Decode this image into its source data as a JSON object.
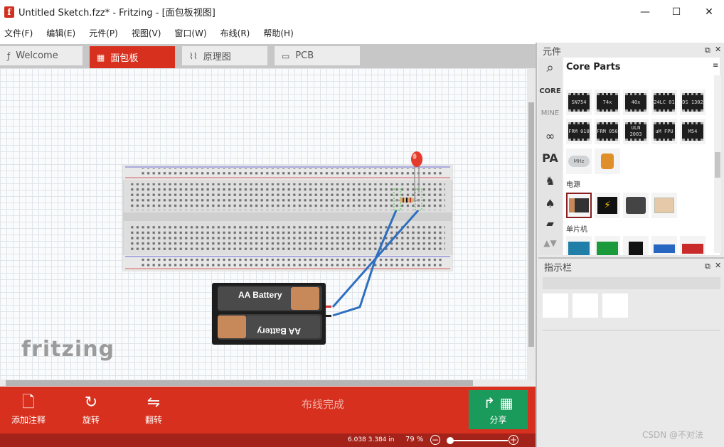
{
  "window": {
    "title": "Untitled Sketch.fzz* - Fritzing - [面包板视图]",
    "minimize": "—",
    "maximize": "☐",
    "close": "✕"
  },
  "menu": [
    "文件(F)",
    "编辑(E)",
    "元件(P)",
    "视图(V)",
    "窗口(W)",
    "布线(R)",
    "帮助(H)"
  ],
  "tabs": [
    {
      "label": "Welcome",
      "icon": "fritzing-f-icon",
      "active": false
    },
    {
      "label": "面包板",
      "icon": "breadboard-icon",
      "active": true
    },
    {
      "label": "原理图",
      "icon": "schematic-icon",
      "active": false
    },
    {
      "label": "PCB",
      "icon": "pcb-icon",
      "active": false
    }
  ],
  "canvas": {
    "watermark": "fritzing",
    "battery_top_label": "AA Battery",
    "battery_bottom_label": "AA Battery",
    "wire_color": "#2f6fc0",
    "led_color": "#e53b2c"
  },
  "toolbar": {
    "add_note": "添加注释",
    "rotate": "旋转",
    "flip": "翻转",
    "routing_status": "布线完成",
    "share": "分享"
  },
  "statusbar": {
    "coords": "6.038 3.384 in",
    "zoom": "79 %",
    "zoom_minus": "−",
    "zoom_plus": "+"
  },
  "parts_panel": {
    "title": "元件",
    "bin_title": "Core Parts",
    "tabs": [
      "CORE",
      "MINE"
    ],
    "section_power": "电源",
    "section_mcu": "单片机",
    "chips_row1": [
      "SN754",
      "74x",
      "40x",
      "24LC 01",
      "DS 1302"
    ],
    "chips_row2": [
      "FRM 010",
      "FRM 050",
      "ULN 2003",
      "uM FPU",
      "M54"
    ],
    "crystal_label": "MHz"
  },
  "inspector": {
    "title": "指示栏"
  },
  "watermark_csdn": "CSDN @不对法"
}
